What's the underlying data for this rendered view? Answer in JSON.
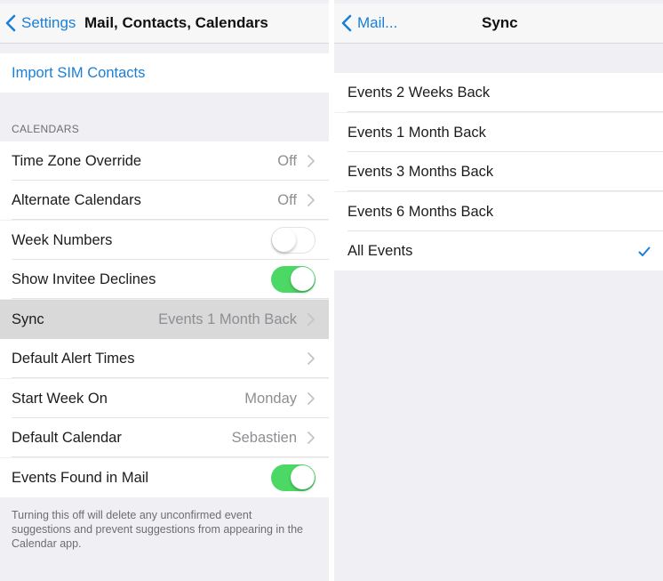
{
  "left": {
    "nav": {
      "back_label": "Settings",
      "title": "Mail, Contacts, Calendars"
    },
    "import_sim": "Import SIM Contacts",
    "section_header": "CALENDARS",
    "rows": [
      {
        "label": "Time Zone Override",
        "value": "Off",
        "type": "disclosure"
      },
      {
        "label": "Alternate Calendars",
        "value": "Off",
        "type": "disclosure"
      },
      {
        "label": "Week Numbers",
        "type": "toggle",
        "on": false
      },
      {
        "label": "Show Invitee Declines",
        "type": "toggle",
        "on": true
      },
      {
        "label": "Sync",
        "value": "Events 1 Month Back",
        "type": "disclosure",
        "highlighted": true
      },
      {
        "label": "Default Alert Times",
        "value": "",
        "type": "disclosure"
      },
      {
        "label": "Start Week On",
        "value": "Monday",
        "type": "disclosure"
      },
      {
        "label": "Default Calendar",
        "value": "Sebastien",
        "type": "disclosure"
      },
      {
        "label": "Events Found in Mail",
        "type": "toggle",
        "on": true
      }
    ],
    "footer": "Turning this off will delete any unconfirmed event suggestions and prevent suggestions from appearing in the Calendar app."
  },
  "right": {
    "nav": {
      "back_label": "Mail...",
      "title": "Sync"
    },
    "options": [
      {
        "label": "Events 2 Weeks Back",
        "selected": false
      },
      {
        "label": "Events 1 Month Back",
        "selected": false
      },
      {
        "label": "Events 3 Months Back",
        "selected": false
      },
      {
        "label": "Events 6 Months Back",
        "selected": false
      },
      {
        "label": "All Events",
        "selected": true
      }
    ]
  },
  "colors": {
    "accent": "#1a7fd6",
    "toggle_on": "#4cd864",
    "background": "#efeff4"
  }
}
